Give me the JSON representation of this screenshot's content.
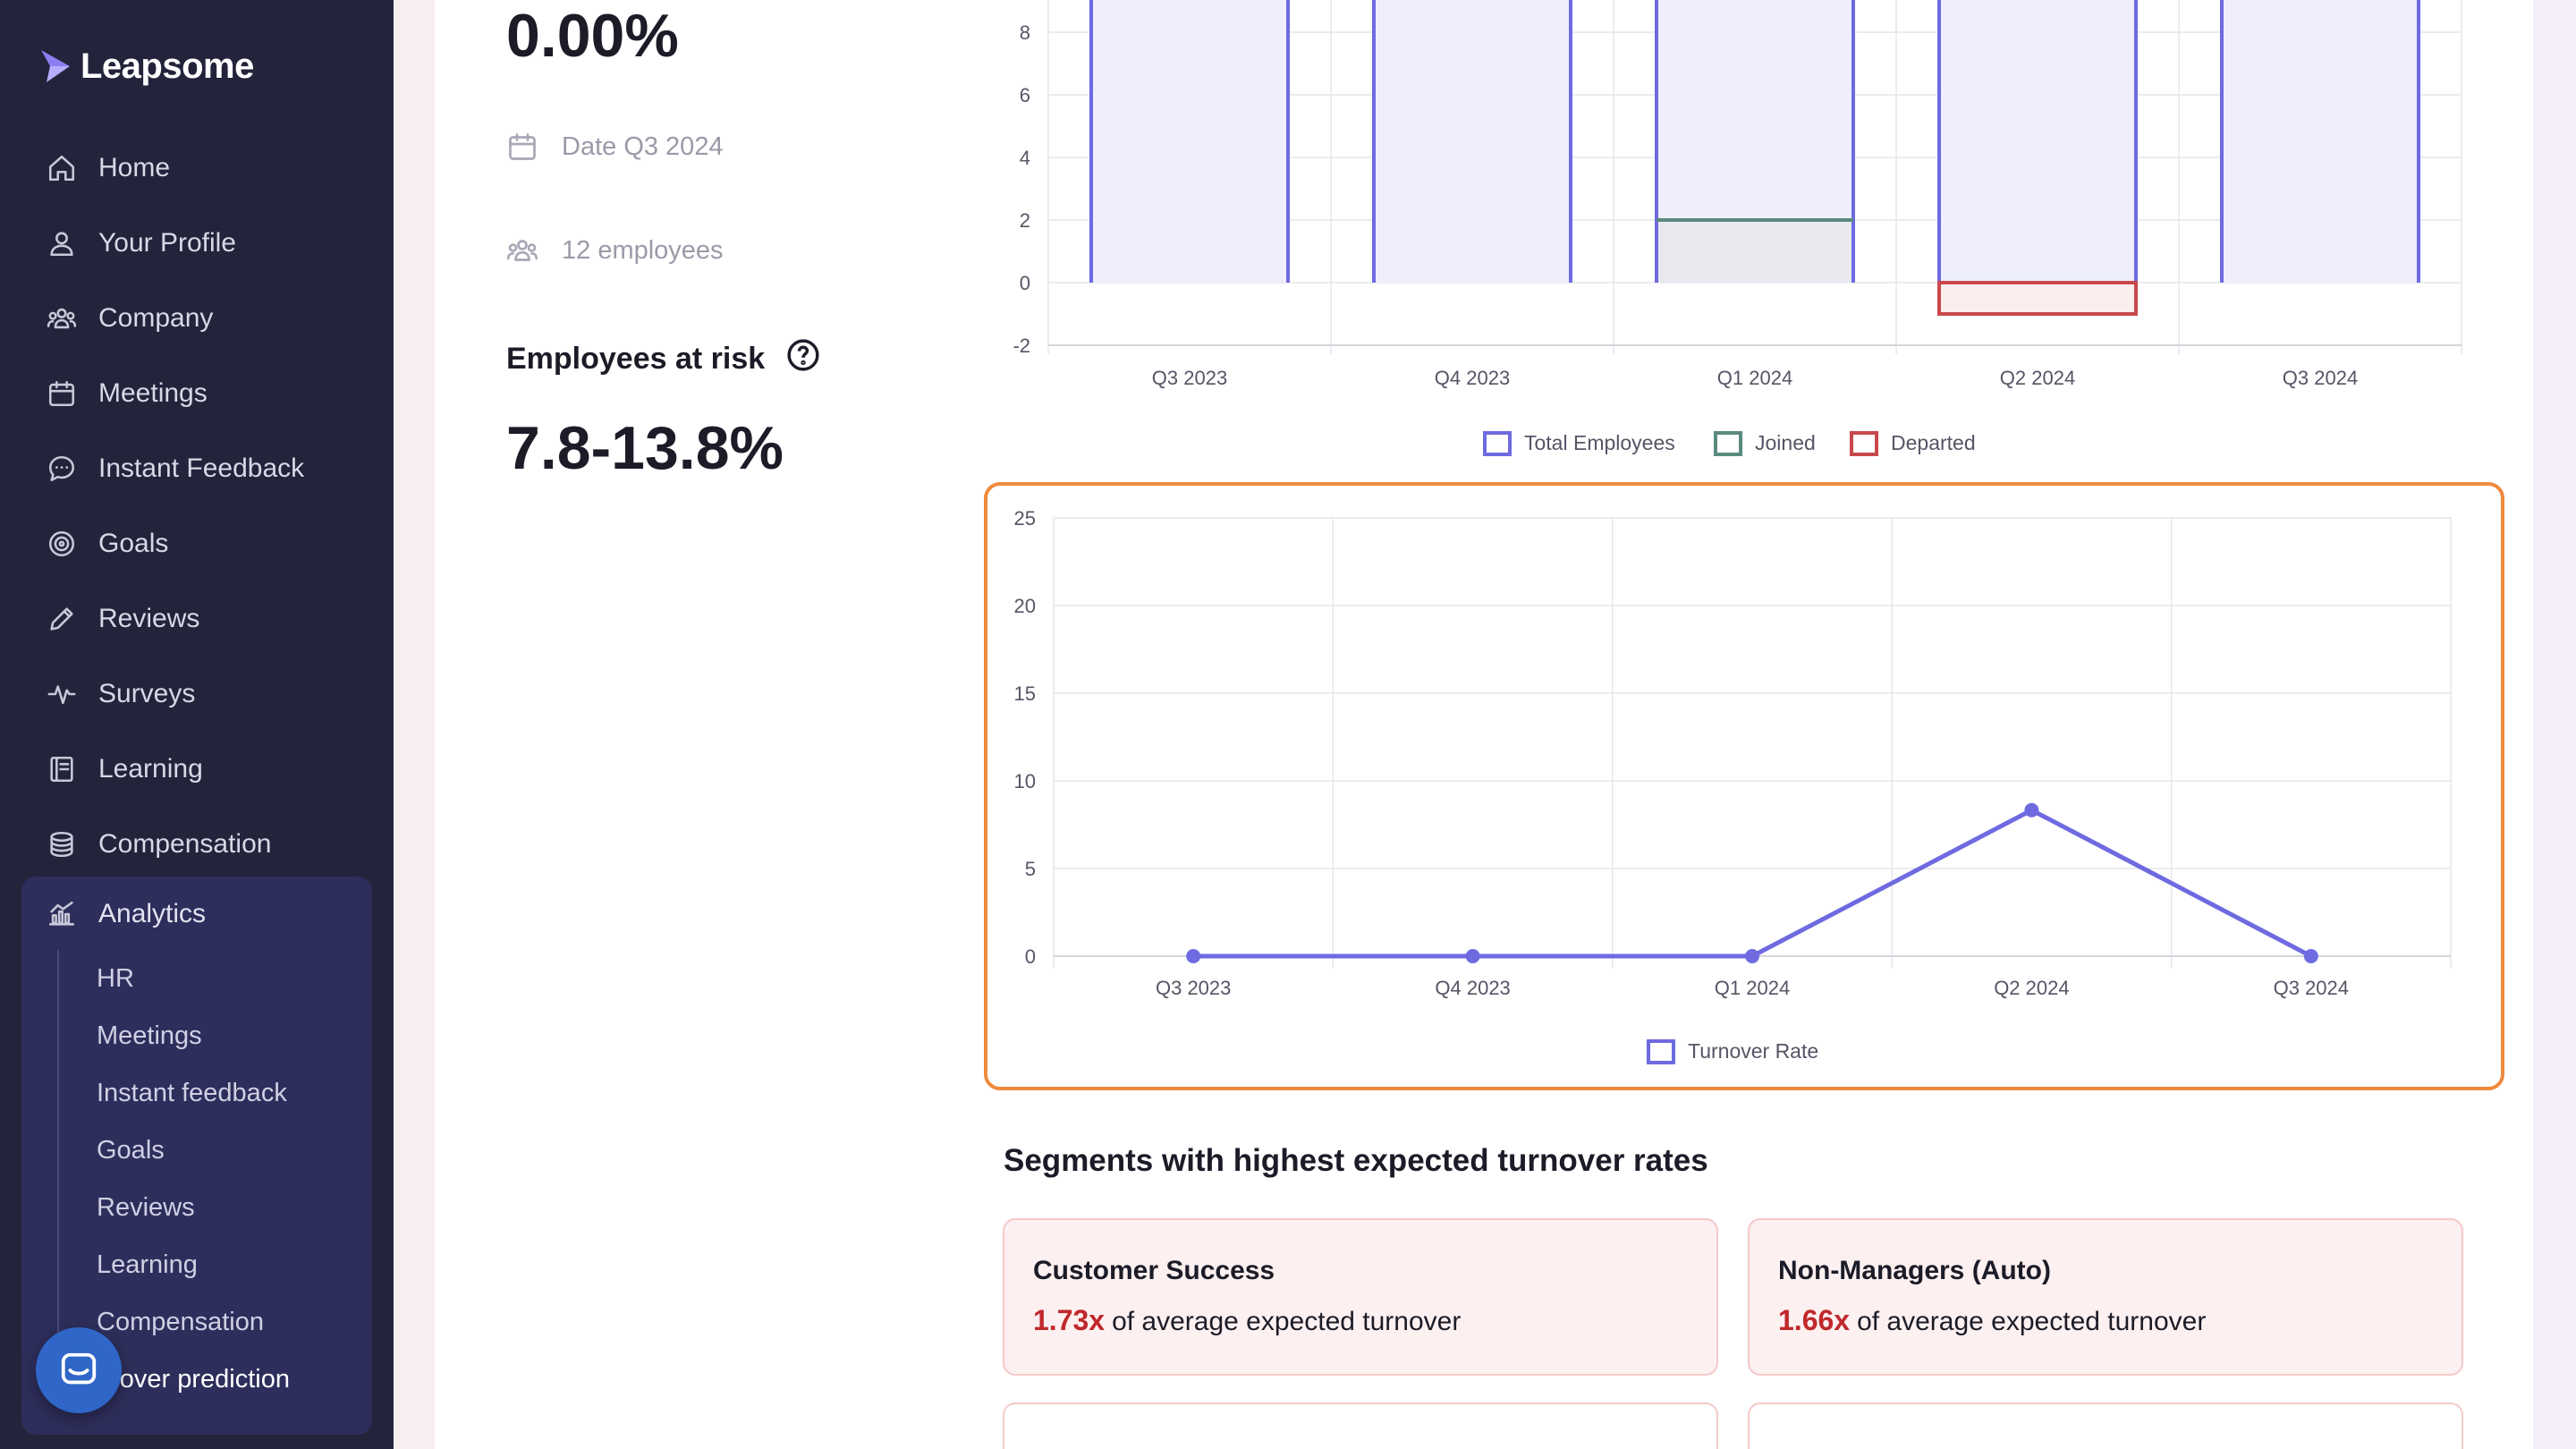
{
  "app": {
    "name": "Leapsome"
  },
  "sidebar": {
    "items": [
      {
        "label": "Home",
        "icon": "home-icon"
      },
      {
        "label": "Your Profile",
        "icon": "user-icon"
      },
      {
        "label": "Company",
        "icon": "people-icon"
      },
      {
        "label": "Meetings",
        "icon": "calendar-icon"
      },
      {
        "label": "Instant Feedback",
        "icon": "chat-icon"
      },
      {
        "label": "Goals",
        "icon": "target-icon"
      },
      {
        "label": "Reviews",
        "icon": "pencil-icon"
      },
      {
        "label": "Surveys",
        "icon": "pulse-icon"
      },
      {
        "label": "Learning",
        "icon": "book-icon"
      },
      {
        "label": "Compensation",
        "icon": "coins-icon"
      }
    ],
    "analytics": {
      "label": "Analytics",
      "icon": "analytics-icon",
      "sub_items": [
        {
          "label": "HR"
        },
        {
          "label": "Meetings"
        },
        {
          "label": "Instant feedback"
        },
        {
          "label": "Goals"
        },
        {
          "label": "Reviews"
        },
        {
          "label": "Learning"
        },
        {
          "label": "Compensation"
        },
        {
          "label": "rnover prediction"
        }
      ]
    }
  },
  "summary": {
    "turnover_value": "0.00%",
    "date_label": "Date Q3 2024",
    "employees_label": "12 employees",
    "risk_title": "Employees at risk",
    "risk_value": "7.8-13.8%"
  },
  "segments": {
    "title": "Segments with highest expected turnover rates",
    "cards": [
      {
        "name": "Customer Success",
        "multiplier": "1.73x",
        "text": "of average expected turnover"
      },
      {
        "name": "Non-Managers (Auto)",
        "multiplier": "1.66x",
        "text": "of average expected turnover"
      }
    ]
  },
  "colors": {
    "accent": "#6e6ae0",
    "joined": "#5b8a7e",
    "departed": "#c9484c",
    "highlight": "#ef8a3c",
    "sidebar_bg": "#23233b",
    "risk_red": "#c0282c"
  },
  "chart_data": [
    {
      "type": "bar",
      "categories": [
        "Q3 2023",
        "Q4 2023",
        "Q1 2024",
        "Q2 2024",
        "Q3 2024"
      ],
      "series": [
        {
          "name": "Total Employees",
          "values": [
            12,
            12,
            12,
            12,
            12
          ]
        },
        {
          "name": "Joined",
          "values": [
            0,
            0,
            2,
            0,
            0
          ]
        },
        {
          "name": "Departed",
          "values": [
            0,
            0,
            0,
            -1,
            0
          ]
        }
      ],
      "y_ticks": [
        -2,
        0,
        2,
        4,
        6,
        8
      ],
      "ylim": [
        -2,
        9
      ],
      "grid": true,
      "legend": "bottom"
    },
    {
      "type": "line",
      "categories": [
        "Q3 2023",
        "Q4 2023",
        "Q1 2024",
        "Q2 2024",
        "Q3 2024"
      ],
      "series": [
        {
          "name": "Turnover Rate",
          "values": [
            0,
            0,
            0,
            8.33,
            0
          ]
        }
      ],
      "y_ticks": [
        0,
        5,
        10,
        15,
        20,
        25
      ],
      "ylim": [
        0,
        25
      ],
      "grid": true,
      "legend": "bottom"
    }
  ]
}
